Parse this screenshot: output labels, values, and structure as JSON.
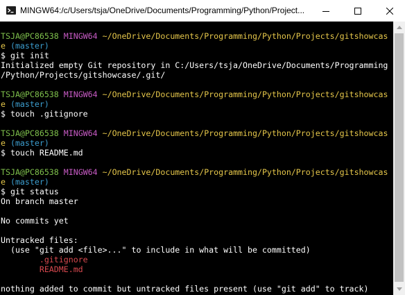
{
  "window": {
    "title": "MINGW64:/c/Users/tsja/OneDrive/Documents/Programming/Python/Project...",
    "icon": "mingw-terminal-icon",
    "controls": [
      "minimize-icon",
      "maximize-icon",
      "close-icon"
    ]
  },
  "colors": {
    "user": "#7fc14c",
    "env": "#c85bc5",
    "path": "#e5c64a",
    "branch": "#3c9ecf",
    "untracked": "#d9494f"
  },
  "terminal": {
    "blocks": [
      {
        "user": "TSJA@PC86538",
        "env": "MINGW64",
        "path_line1": "~/OneDrive/Documents/Programming/Python/Projects/gitshowcas",
        "path_line2": "e",
        "branch": "(master)",
        "command": "$ git init",
        "output": [
          "Initialized empty Git repository in C:/Users/tsja/OneDrive/Documents/Programming",
          "/Python/Projects/gitshowcase/.git/"
        ]
      },
      {
        "user": "TSJA@PC86538",
        "env": "MINGW64",
        "path_line1": "~/OneDrive/Documents/Programming/Python/Projects/gitshowcas",
        "path_line2": "e",
        "branch": "(master)",
        "command": "$ touch .gitignore"
      },
      {
        "user": "TSJA@PC86538",
        "env": "MINGW64",
        "path_line1": "~/OneDrive/Documents/Programming/Python/Projects/gitshowcas",
        "path_line2": "e",
        "branch": "(master)",
        "command": "$ touch README.md"
      },
      {
        "user": "TSJA@PC86538",
        "env": "MINGW64",
        "path_line1": "~/OneDrive/Documents/Programming/Python/Projects/gitshowcas",
        "path_line2": "e",
        "branch": "(master)",
        "command": "$ git status",
        "status": {
          "on_branch": "On branch master",
          "no_commits": "No commits yet",
          "untracked_header": "Untracked files:",
          "hint": "  (use \"git add <file>...\" to include in what will be committed)",
          "files": [
            "        .gitignore",
            "        README.md"
          ],
          "summary": "nothing added to commit but untracked files present (use \"git add\" to track)"
        }
      }
    ]
  }
}
